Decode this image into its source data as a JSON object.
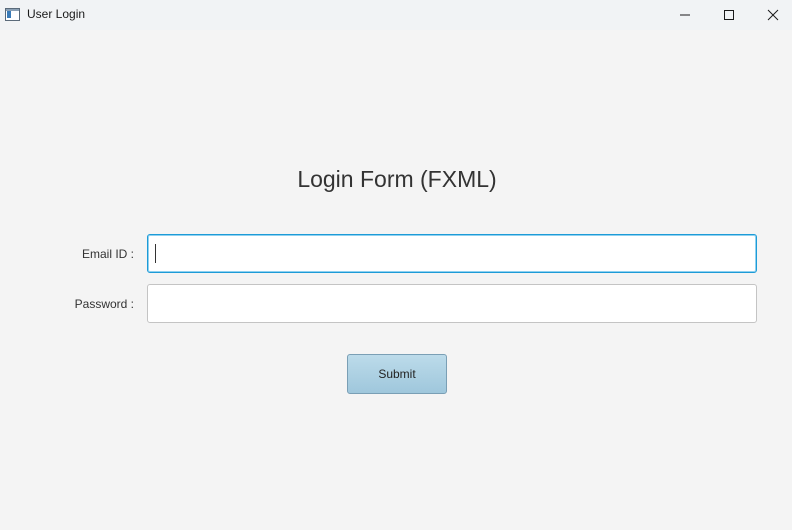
{
  "window": {
    "title": "User Login",
    "controls": [
      "minimize-icon",
      "maximize-icon",
      "close-icon"
    ]
  },
  "form": {
    "title": "Login Form (FXML)",
    "email_label": "Email ID :",
    "email_value": "",
    "password_label": "Password :",
    "password_value": "",
    "submit_label": "Submit"
  },
  "colors": {
    "focus_border": "#1d9bd7",
    "button_top": "#bcdbea",
    "button_bottom": "#9fc7dc",
    "background": "#f4f4f4"
  }
}
